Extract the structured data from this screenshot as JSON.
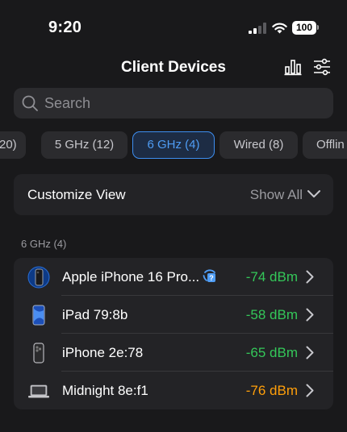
{
  "status_bar": {
    "time": "9:20",
    "battery": "100"
  },
  "header": {
    "title": "Client Devices",
    "chart_icon": "bar-chart-icon",
    "filter_icon": "sliders-icon"
  },
  "search": {
    "placeholder": "Search"
  },
  "filters": [
    {
      "label": "(20)",
      "active": false
    },
    {
      "label": "5 GHz (12)",
      "active": false
    },
    {
      "label": "6 GHz (4)",
      "active": true
    },
    {
      "label": "Wired (8)",
      "active": false
    },
    {
      "label": "Offlin",
      "active": false
    }
  ],
  "customize": {
    "label": "Customize View",
    "value": "Show All"
  },
  "section": {
    "title": "6 GHz (4)"
  },
  "devices": [
    {
      "name": "Apple iPhone 16 Pro...",
      "signal": "-74 dBm",
      "quality": "good",
      "icon": "iphone-16-pro-icon",
      "badge": "unknown-device-badge-icon"
    },
    {
      "name": "iPad 79:8b",
      "signal": "-58 dBm",
      "quality": "good",
      "icon": "ipad-icon"
    },
    {
      "name": "iPhone 2e:78",
      "signal": "-65 dBm",
      "quality": "good",
      "icon": "iphone-icon"
    },
    {
      "name": "Midnight 8e:f1",
      "signal": "-76 dBm",
      "quality": "fair",
      "icon": "macbook-icon"
    }
  ],
  "colors": {
    "accent": "#3d8ef0",
    "good": "#34c759",
    "fair": "#ff9f0a",
    "background": "#19191b"
  }
}
